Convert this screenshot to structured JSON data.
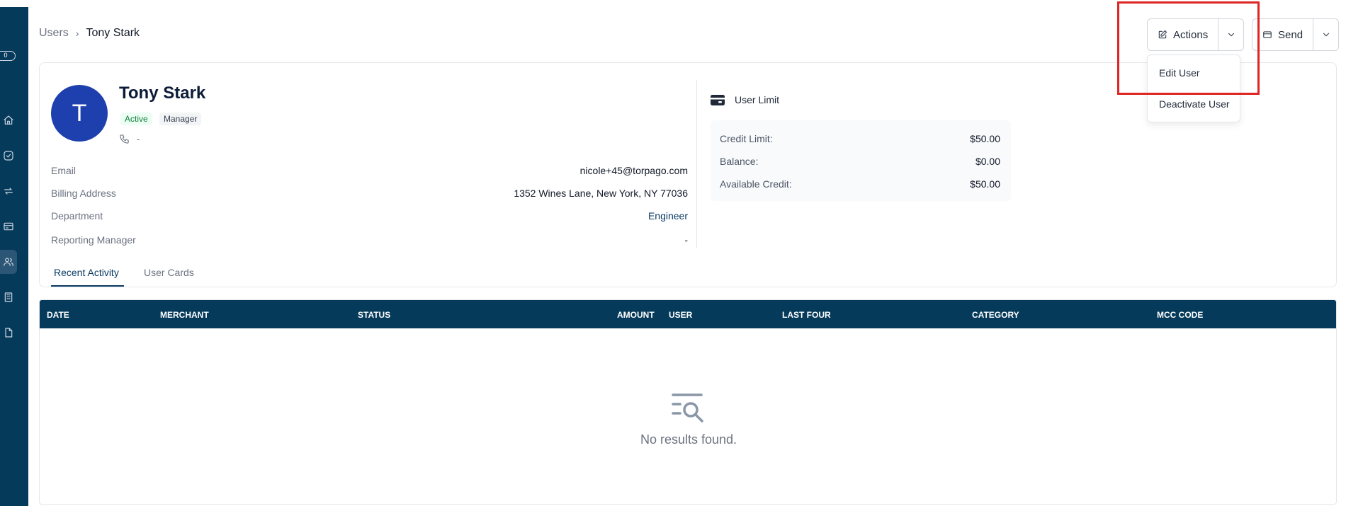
{
  "sidebar": {
    "toggle_value": "0",
    "items": [
      {
        "name": "home-icon"
      },
      {
        "name": "check-circle-icon"
      },
      {
        "name": "transfer-icon"
      },
      {
        "name": "card-icon"
      },
      {
        "name": "users-icon"
      },
      {
        "name": "building-icon"
      },
      {
        "name": "document-icon"
      }
    ],
    "active_index": 4
  },
  "breadcrumb": {
    "parent": "Users",
    "current": "Tony Stark"
  },
  "header": {
    "actions_label": "Actions",
    "send_label": "Send"
  },
  "actions_menu": {
    "items": [
      "Edit User",
      "Deactivate User"
    ]
  },
  "profile": {
    "avatar_initial": "T",
    "name": "Tony Stark",
    "status_badge": "Active",
    "role_badge": "Manager",
    "phone": "-",
    "fields": [
      {
        "label": "Email",
        "value": "nicole+45@torpago.com"
      },
      {
        "label": "Billing Address",
        "value": "1352 Wines Lane, New York, NY 77036"
      },
      {
        "label": "Department",
        "value": "Engineer"
      },
      {
        "label": "Reporting Manager",
        "value": "-"
      }
    ]
  },
  "user_limit": {
    "title": "User Limit",
    "rows": [
      {
        "label": "Credit Limit:",
        "value": "$50.00"
      },
      {
        "label": "Balance:",
        "value": "$0.00"
      },
      {
        "label": "Available Credit:",
        "value": "$50.00"
      }
    ]
  },
  "tabs": [
    {
      "label": "Recent Activity",
      "active": true
    },
    {
      "label": "User Cards",
      "active": false
    }
  ],
  "table": {
    "columns": [
      "DATE",
      "MERCHANT",
      "STATUS",
      "AMOUNT",
      "USER",
      "LAST FOUR",
      "CATEGORY",
      "MCC CODE"
    ],
    "rows": [],
    "empty_message": "No results found."
  },
  "colors": {
    "brand_navy": "#063a5b",
    "avatar_blue": "#1e40af",
    "active_green": "#15803d",
    "highlight_red": "#e02424"
  }
}
